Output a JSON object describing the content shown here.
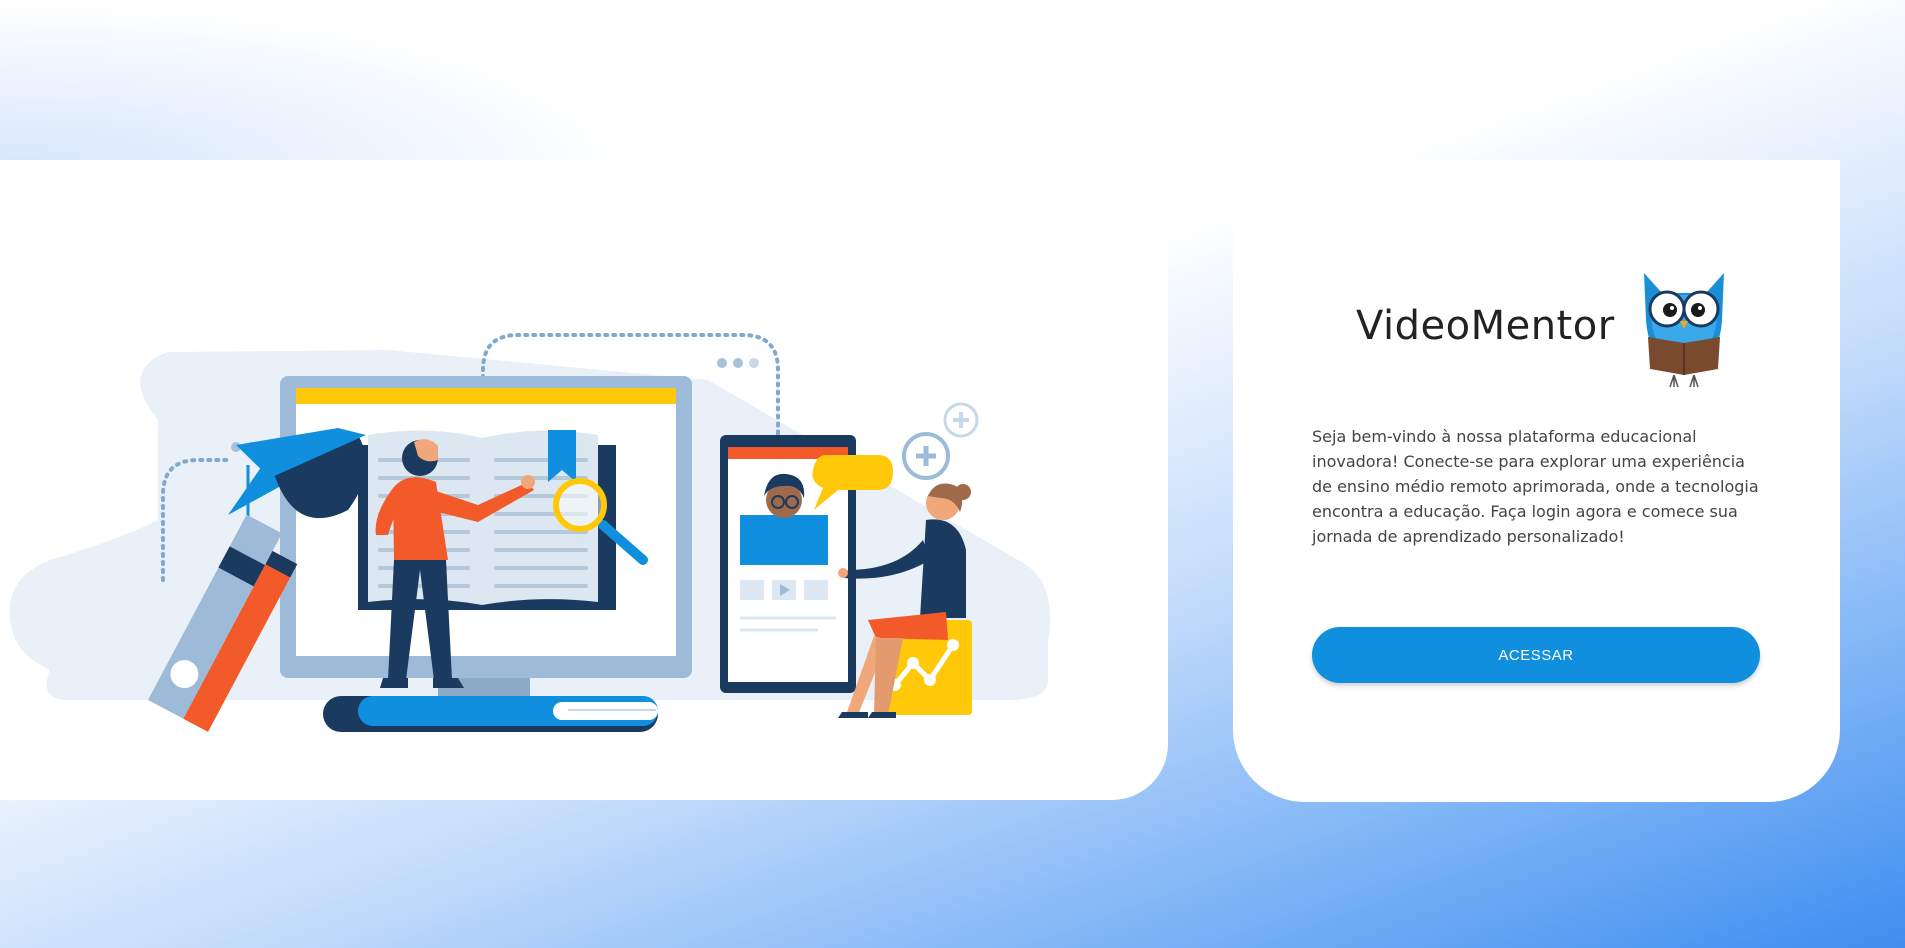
{
  "brand": {
    "title": "VideoMentor",
    "logo_icon": "owl-reading-book-icon"
  },
  "welcome": {
    "text": "Seja bem-vindo à nossa plataforma educacional inovadora! Conecte-se para explorar uma experiência de ensino médio remoto aprimorada, onde a tecnologia encontra a educação. Faça login agora e comece sua jornada de aprendizado personalizado!"
  },
  "actions": {
    "access_label": "ACESSAR"
  },
  "illustration": {
    "icon": "online-education-illustration"
  },
  "colors": {
    "primary": "#0f8fde",
    "accent_orange": "#f25a29",
    "accent_yellow": "#ffc808",
    "navy": "#1a3a5f",
    "light_blue": "#9dbbd8"
  }
}
